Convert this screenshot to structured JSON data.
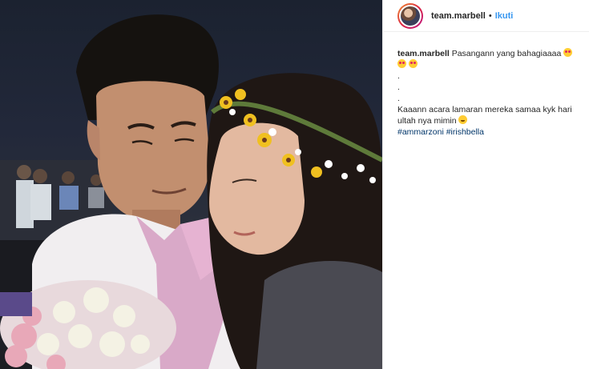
{
  "header": {
    "username": "team.marbell",
    "separator": "•",
    "follow_label": "Ikuti"
  },
  "caption": {
    "username": "team.marbell",
    "line1": "Pasangann yang bahagiaaaa",
    "dots": [
      ".",
      ".",
      "."
    ],
    "line2": "Kaaann acara lamaran mereka samaa kyk hari ultah nya mimin",
    "hashtags": [
      "#ammarzoni",
      "#irishbella"
    ]
  },
  "icons": {
    "heart_eyes": "heart-eyes-emoji-icon",
    "grin": "grinning-emoji-icon"
  },
  "colors": {
    "accent": "#3897f0",
    "hashtag": "#003569",
    "text": "#262626"
  }
}
